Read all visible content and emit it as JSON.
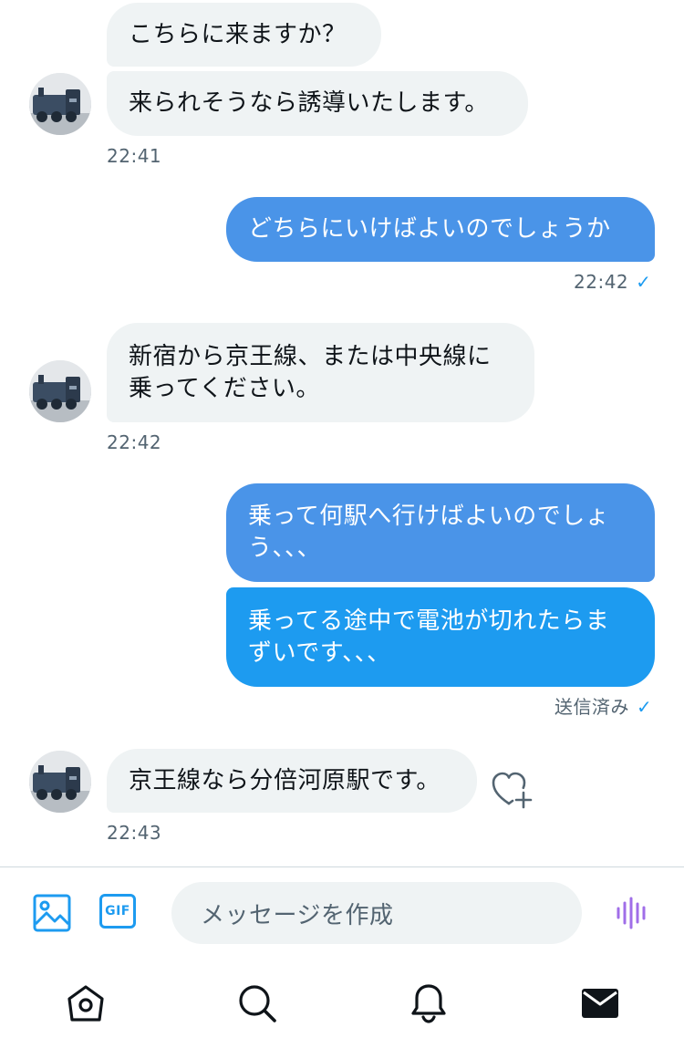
{
  "messages": [
    {
      "side": "in",
      "lines": [
        "こちらに来ますか？"
      ]
    },
    {
      "side": "in",
      "lines": [
        "来られそうなら誘導いたします。"
      ]
    },
    {
      "side": "out",
      "lines": [
        "どちらにいけばよいのでしょうか"
      ]
    },
    {
      "side": "in",
      "lines": [
        "新宿から京王線、または中央線に",
        "乗ってください。"
      ]
    },
    {
      "side": "out",
      "lines": [
        "乗って何駅へ行けばよいのでしょ",
        "う、、、"
      ]
    },
    {
      "side": "out",
      "lines": [
        "乗ってる途中で電池が切れたらま",
        "ずいです、、、"
      ]
    },
    {
      "side": "in",
      "lines": [
        "京王線なら分倍河原駅です。"
      ]
    }
  ],
  "timestamps": {
    "t1": "22:41",
    "t2": "22:42",
    "t3": "22:42",
    "status": "送信済み",
    "t4": "22:43"
  },
  "status_check_glyph": "✓",
  "composer": {
    "placeholder": "メッセージを作成",
    "gif_label": "GIF"
  },
  "icons": {
    "image": "image-icon",
    "gif": "gif-icon",
    "voice": "voice-icon",
    "heart": "heart-plus-icon",
    "home": "home-icon",
    "search": "search-icon",
    "notifications": "bell-icon",
    "messages": "mail-icon"
  },
  "colors": {
    "accent": "#1d9bf0",
    "outgoing_bubble": "#1d9bf0",
    "incoming_bubble": "#eff3f4",
    "voice": "#a06ee8"
  }
}
